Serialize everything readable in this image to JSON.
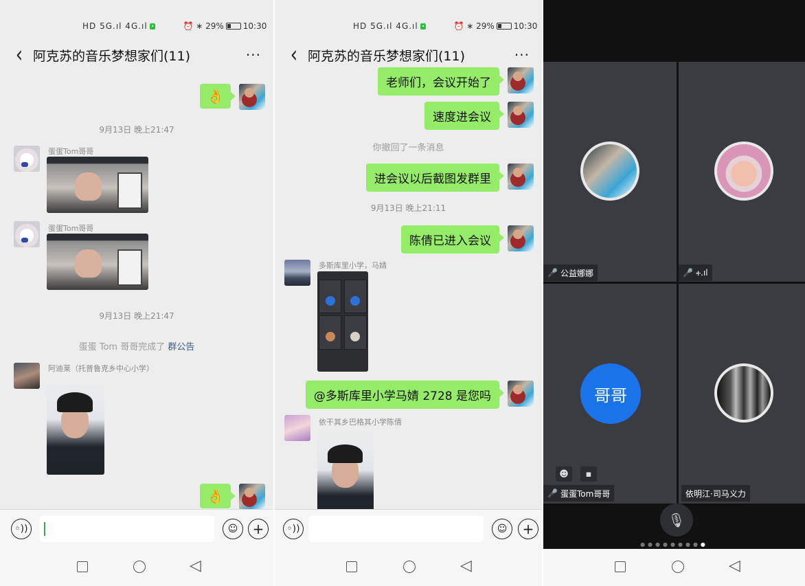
{
  "status": {
    "signal": "HD 5G.ıl 4G.ıl",
    "right": "⏰ ∗ 29%",
    "time": "10:30"
  },
  "chat_title": "阿克苏的音乐梦想家们(11)",
  "more": "···",
  "panel1": {
    "time1": "9月13日 晚上21:47",
    "sender1": "蛋蛋Tom哥哥",
    "sender2": "蛋蛋Tom哥哥",
    "time2": "9月13日 晚上21:47",
    "notice_prefix": "蛋蛋 Tom 哥哥完成了 ",
    "notice_link": "群公告",
    "sender3": "阿迪莱（托普鲁克乡中心小学）",
    "emoji": "👌"
  },
  "panel2": {
    "msg1": "老师们，会议开始了",
    "msg2": "速度进会议",
    "recall": "你撤回了一条消息",
    "msg3": "进会议以后截图发群里",
    "time1": "9月13日 晚上21:11",
    "msg4": "陈倩已进入会议",
    "sender1": "多斯库里小学，马婧",
    "msg5": "@多斯库里小学马婧 2728 是您吗",
    "sender2": "依干其乡巴格其小学陈倩"
  },
  "meeting": {
    "p1_name": "公益娜娜",
    "p2_name": "🕂.ıl",
    "p3_name": "蛋蛋Tom哥哥",
    "p3_avatar_text": "哥哥",
    "p4_name": "依明江·司马义力"
  }
}
